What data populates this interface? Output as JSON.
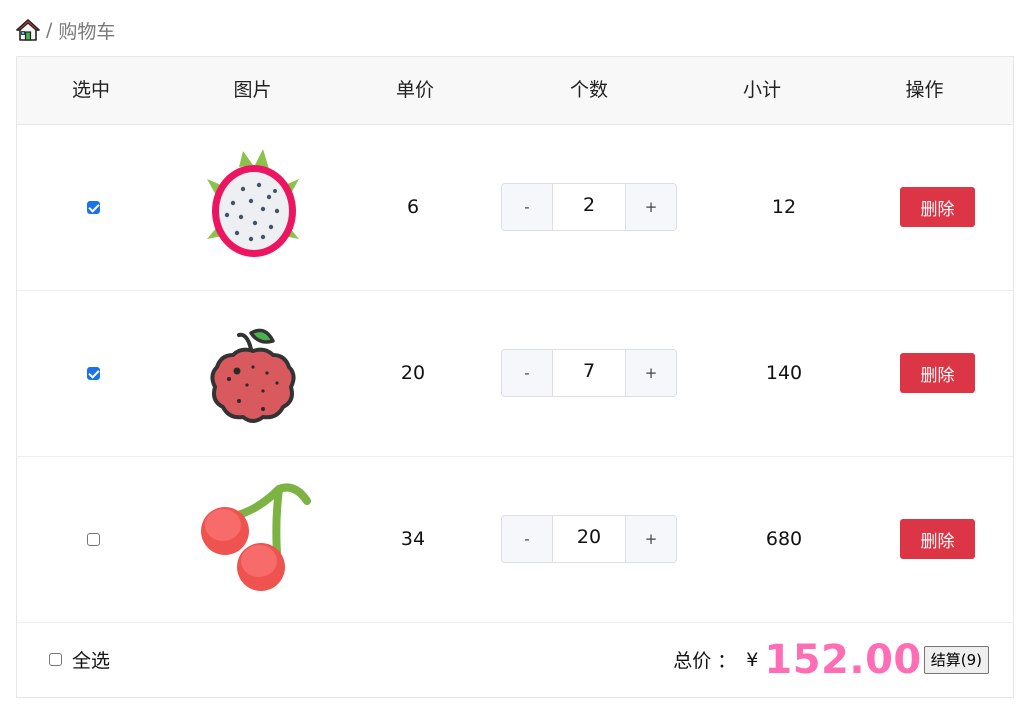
{
  "breadcrumb": {
    "separator": "/",
    "current": "购物车"
  },
  "table": {
    "headers": [
      "选中",
      "图片",
      "单价",
      "个数",
      "小计",
      "操作"
    ],
    "rows": [
      {
        "checked": true,
        "image": "dragon-fruit",
        "price": "6",
        "quantity": "2",
        "subtotal": "12",
        "delete_label": "删除"
      },
      {
        "checked": true,
        "image": "lychee",
        "price": "20",
        "quantity": "7",
        "subtotal": "140",
        "delete_label": "删除"
      },
      {
        "checked": false,
        "image": "cherry",
        "price": "34",
        "quantity": "20",
        "subtotal": "680",
        "delete_label": "删除"
      }
    ],
    "stepper": {
      "minus": "-",
      "plus": "+"
    }
  },
  "footer": {
    "select_all_checked": false,
    "select_all_label": "全选",
    "total_label": "总价 ：",
    "currency": "¥",
    "total_amount": "152.00",
    "checkout_label": "结算(9)"
  },
  "colors": {
    "accent": "#1a73e8",
    "danger": "#dc3545",
    "total": "#ff6eb4"
  }
}
